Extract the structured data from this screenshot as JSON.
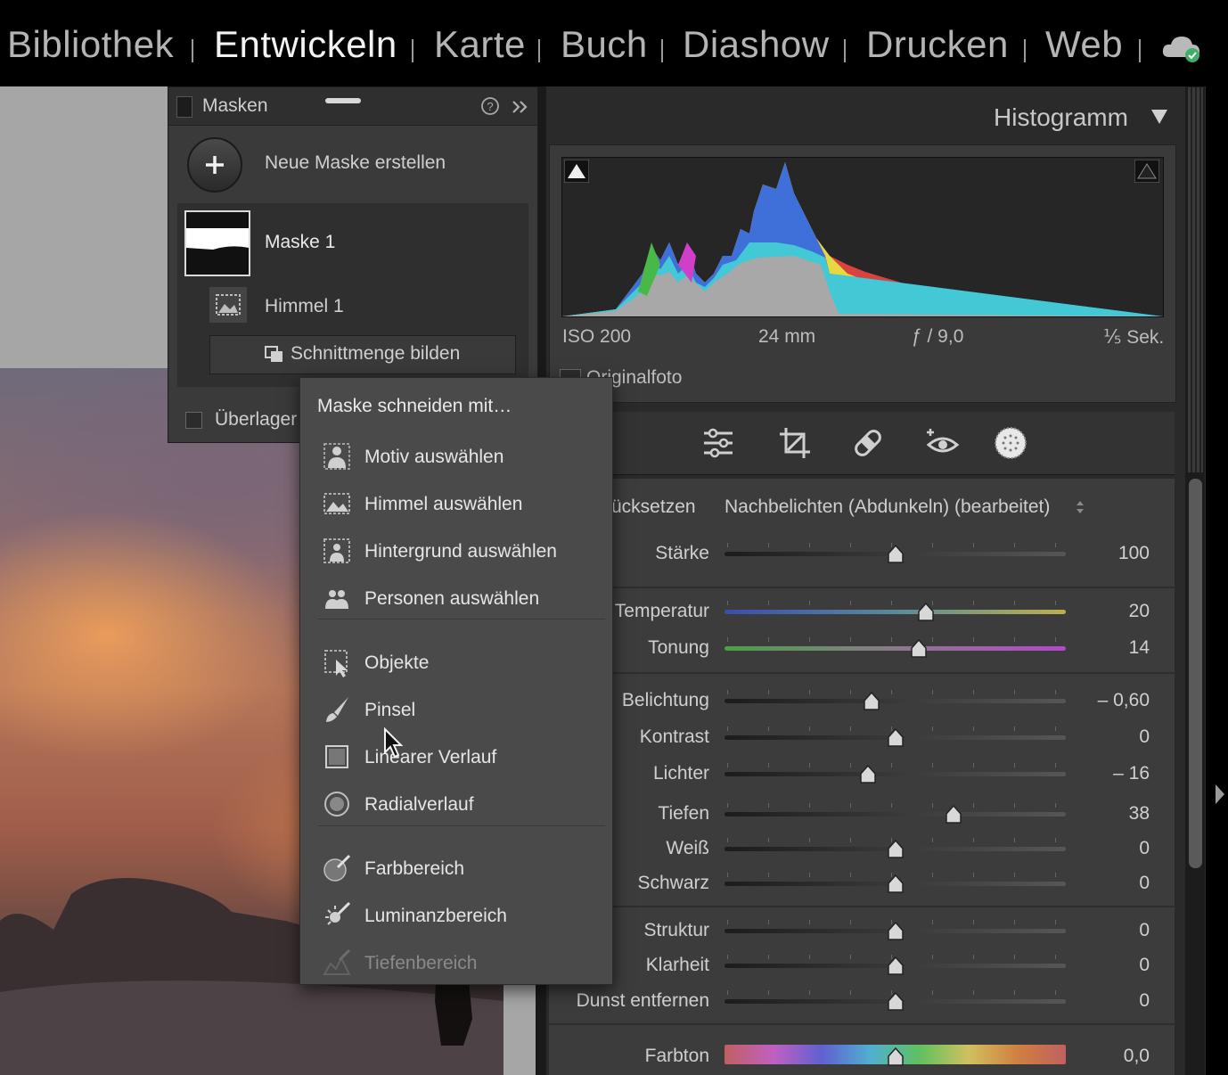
{
  "modules": [
    "Bibliothek",
    "Entwickeln",
    "Karte",
    "Buch",
    "Diashow",
    "Drucken",
    "Web"
  ],
  "active_module": "Entwickeln",
  "mask_panel": {
    "title": "Masken",
    "new_mask_label": "Neue Maske erstellen",
    "mask_name": "Maske 1",
    "component_name": "Himmel 1",
    "intersect_button": "Schnittmenge bilden",
    "overlay_label": "Überlager"
  },
  "histogram": {
    "title": "Histogramm",
    "iso": "ISO 200",
    "focal": "24 mm",
    "aperture": "ƒ / 9,0",
    "shutter": "⅕ Sek.",
    "original_label": "Originalfoto"
  },
  "context_menu": {
    "title": "Maske schneiden mit…",
    "items": [
      {
        "label": "Motiv auswählen",
        "icon": "subject-icon",
        "enabled": true
      },
      {
        "label": "Himmel auswählen",
        "icon": "sky-icon",
        "enabled": true
      },
      {
        "label": "Hintergrund auswählen",
        "icon": "background-icon",
        "enabled": true
      },
      {
        "label": "Personen auswählen",
        "icon": "people-icon",
        "enabled": true
      },
      {
        "label": "Objekte",
        "icon": "objects-icon",
        "enabled": true
      },
      {
        "label": "Pinsel",
        "icon": "brush-icon",
        "enabled": true
      },
      {
        "label": "Linearer Verlauf",
        "icon": "linear-gradient-icon",
        "enabled": true
      },
      {
        "label": "Radialverlauf",
        "icon": "radial-gradient-icon",
        "enabled": true
      },
      {
        "label": "Farbbereich",
        "icon": "color-range-icon",
        "enabled": true
      },
      {
        "label": "Luminanzbereich",
        "icon": "luminance-range-icon",
        "enabled": true
      },
      {
        "label": "Tiefenbereich",
        "icon": "depth-range-icon",
        "enabled": false
      }
    ]
  },
  "adjust": {
    "reset_label": "ücksetzen",
    "preset": "Nachbelichten (Abdunkeln) (bearbeitet)",
    "sliders": [
      {
        "label": "Stärke",
        "value": "100",
        "pos": 0.5
      },
      {
        "label": "Temperatur",
        "value": "20",
        "pos": 0.59
      },
      {
        "label": "Tonung",
        "value": "14",
        "pos": 0.57
      },
      {
        "label": "Belichtung",
        "value": "– 0,60",
        "pos": 0.43
      },
      {
        "label": "Kontrast",
        "value": "0",
        "pos": 0.5
      },
      {
        "label": "Lichter",
        "value": "– 16",
        "pos": 0.42
      },
      {
        "label": "Tiefen",
        "value": "38",
        "pos": 0.67
      },
      {
        "label": "Weiß",
        "value": "0",
        "pos": 0.5
      },
      {
        "label": "Schwarz",
        "value": "0",
        "pos": 0.5
      },
      {
        "label": "Struktur",
        "value": "0",
        "pos": 0.5
      },
      {
        "label": "Klarheit",
        "value": "0",
        "pos": 0.5
      },
      {
        "label": "Dunst entfernen",
        "value": "0",
        "pos": 0.5
      },
      {
        "label": "Farbton",
        "value": "0,0",
        "pos": 0.5
      }
    ]
  },
  "tool_icons": [
    "edit-sliders-icon",
    "crop-icon",
    "healing-icon",
    "redeye-icon",
    "masking-icon"
  ],
  "colors": {
    "accent_green": "#3fae6a",
    "panel_bg": "#3c3c3c"
  }
}
